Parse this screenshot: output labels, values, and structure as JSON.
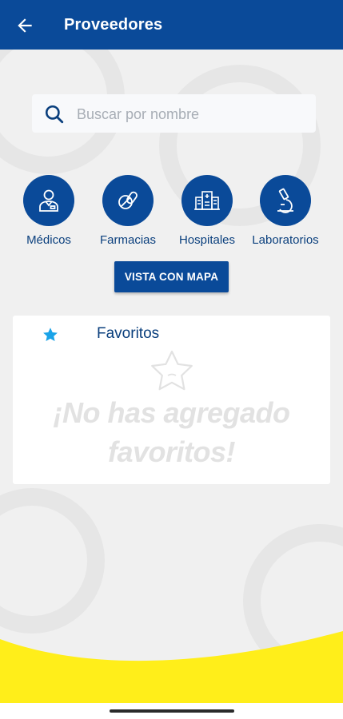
{
  "header": {
    "title": "Proveedores",
    "back_icon": "arrow-left-icon"
  },
  "search": {
    "placeholder": "Buscar por nombre",
    "value": "",
    "icon": "search-icon"
  },
  "categories": [
    {
      "label": "Médicos",
      "icon": "doctor-icon"
    },
    {
      "label": "Farmacias",
      "icon": "pills-icon"
    },
    {
      "label": "Hospitales",
      "icon": "hospital-icon"
    },
    {
      "label": "Laboratorios",
      "icon": "microscope-icon"
    }
  ],
  "map_button": {
    "label": "VISTA CON MAPA"
  },
  "favorites": {
    "title": "Favoritos",
    "icon": "star-icon",
    "empty_message_line1": "¡No has agregado",
    "empty_message_line2": "favoritos!"
  },
  "colors": {
    "primary": "#0a4a99",
    "accent_star": "#1aa3e8",
    "wave": "#ffee1a",
    "background": "#f0f0f0"
  }
}
